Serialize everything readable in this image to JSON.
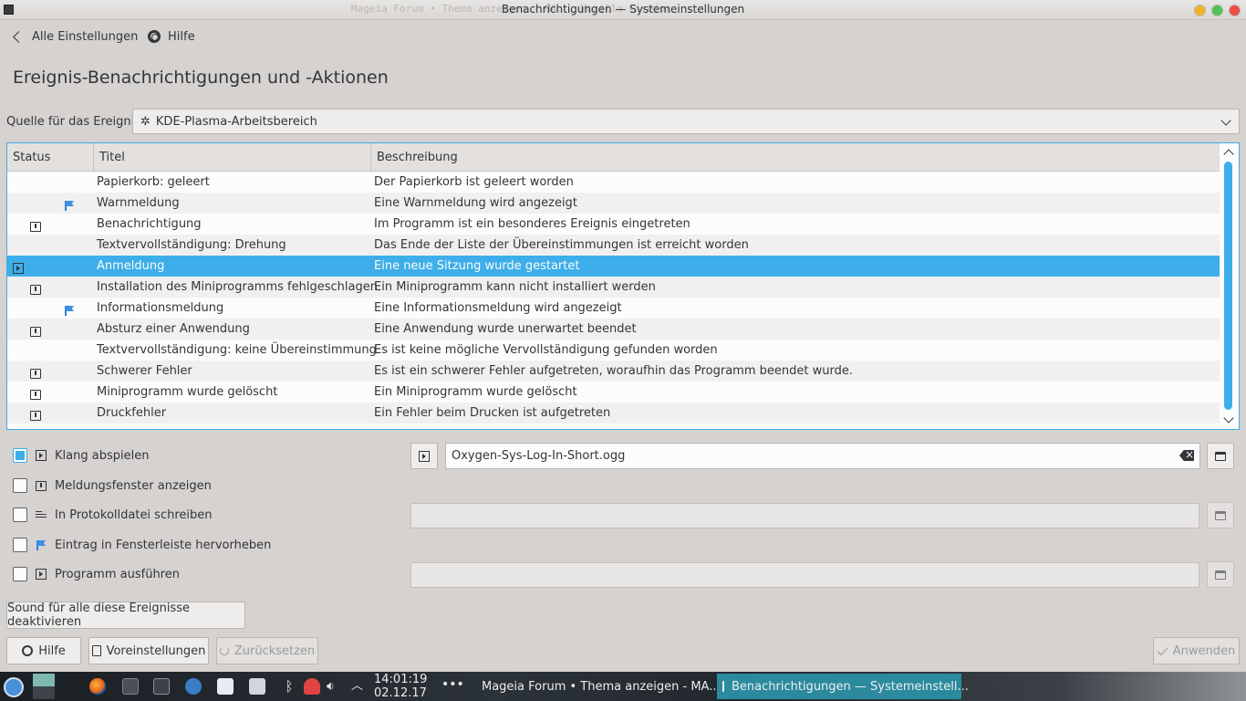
{
  "window": {
    "title": "Benachrichtigungen — Systemeinstellungen",
    "background_title": "Mageia Forum • Thema anzeigen - MA... Mozilla Firefox"
  },
  "nav": {
    "back_label": "Alle Einstellungen",
    "help_label": "Hilfe"
  },
  "page_title": "Ereignis-Benachrichtigungen und -Aktionen",
  "source": {
    "label": "Quelle für das Ereignis:",
    "value": "KDE-Plasma-Arbeitsbereich"
  },
  "table": {
    "columns": [
      "Status",
      "Titel",
      "Beschreibung"
    ],
    "rows": [
      {
        "play": false,
        "msg": false,
        "flag": false,
        "title": "Papierkorb: geleert",
        "desc": "Der Papierkorb ist geleert worden"
      },
      {
        "play": false,
        "msg": false,
        "flag": true,
        "title": "Warnmeldung",
        "desc": "Eine Warnmeldung wird angezeigt"
      },
      {
        "play": false,
        "msg": true,
        "flag": false,
        "title": "Benachrichtigung",
        "desc": "Im Programm ist ein besonderes Ereignis eingetreten"
      },
      {
        "play": false,
        "msg": false,
        "flag": false,
        "title": "Textvervollständigung: Drehung",
        "desc": "Das Ende der Liste der Übereinstimmungen ist erreicht worden"
      },
      {
        "play": true,
        "msg": false,
        "flag": false,
        "title": "Anmeldung",
        "desc": "Eine neue Sitzung wurde gestartet",
        "selected": true
      },
      {
        "play": false,
        "msg": true,
        "flag": false,
        "title": "Installation des Miniprogramms fehlgeschlagen",
        "desc": "Ein Miniprogramm kann nicht installiert werden"
      },
      {
        "play": false,
        "msg": false,
        "flag": true,
        "title": "Informationsmeldung",
        "desc": "Eine Informationsmeldung wird angezeigt"
      },
      {
        "play": false,
        "msg": true,
        "flag": false,
        "title": "Absturz einer Anwendung",
        "desc": "Eine Anwendung wurde unerwartet beendet"
      },
      {
        "play": false,
        "msg": false,
        "flag": false,
        "title": "Textvervollständigung: keine Übereinstimmung",
        "desc": "Es ist keine mögliche Vervollständigung gefunden worden"
      },
      {
        "play": false,
        "msg": true,
        "flag": false,
        "title": "Schwerer Fehler",
        "desc": "Es ist ein schwerer Fehler aufgetreten, woraufhin das Programm beendet wurde."
      },
      {
        "play": false,
        "msg": true,
        "flag": false,
        "title": "Miniprogramm wurde gelöscht",
        "desc": "Ein Miniprogramm wurde gelöscht"
      },
      {
        "play": false,
        "msg": true,
        "flag": false,
        "title": "Druckfehler",
        "desc": "Ein Fehler beim Drucken ist aufgetreten"
      }
    ]
  },
  "actions": {
    "play_sound": {
      "label": "Klang abspielen",
      "checked": true,
      "file": "Oxygen-Sys-Log-In-Short.ogg"
    },
    "show_popup": {
      "label": "Meldungsfenster anzeigen",
      "checked": false
    },
    "log_file": {
      "label": "In Protokolldatei schreiben",
      "checked": false
    },
    "taskbar": {
      "label": "Eintrag in Fensterleiste hervorheben",
      "checked": false
    },
    "run_command": {
      "label": "Programm ausführen",
      "checked": false
    }
  },
  "buttons": {
    "disable_sounds": "Sound für alle diese Ereignisse deaktivieren",
    "help": "Hilfe",
    "defaults": "Voreinstellungen",
    "reset": "Zurücksetzen",
    "apply": "Anwenden"
  },
  "taskbar": {
    "time": "14:01:19",
    "date": "02.12.17",
    "tasks": [
      {
        "label": "Mageia Forum • Thema anzeigen - MA...",
        "active": false
      },
      {
        "label": "Benachrichtigungen — Systemeinstell...",
        "active": true
      }
    ]
  },
  "colors": {
    "accent": "#3daee9",
    "background": "#d6d2d0",
    "text": "#31363b"
  }
}
